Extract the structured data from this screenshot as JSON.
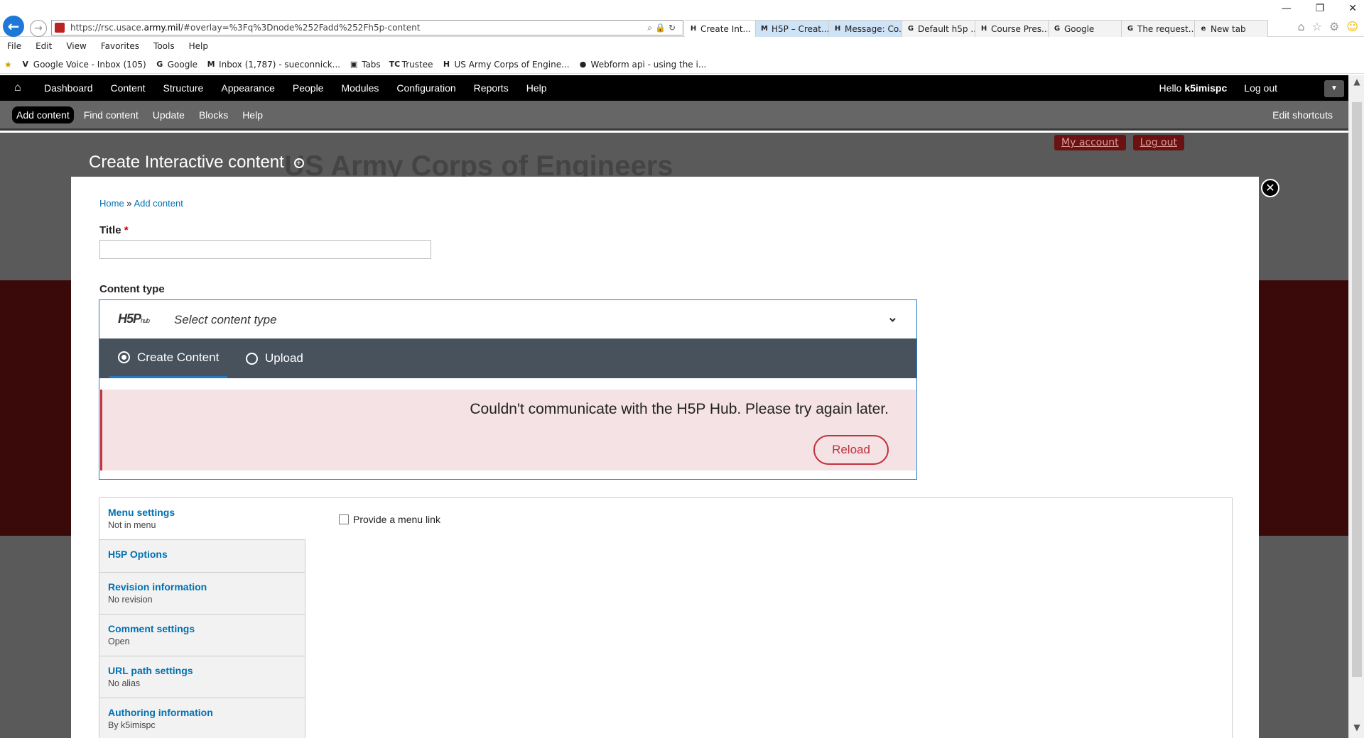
{
  "browser": {
    "url_prefix": "https://rsc.usace.",
    "url_host": "army.mil",
    "url_rest": "/#overlay=%3Fq%3Dnode%252Fadd%252Fh5p-content",
    "tabs": [
      {
        "label": "Create Int...",
        "icon": "H"
      },
      {
        "label": "H5P – Creat...",
        "icon": "M"
      },
      {
        "label": "Message: Co...",
        "icon": "H"
      },
      {
        "label": "Default h5p ...",
        "icon": "G"
      },
      {
        "label": "Course Pres...",
        "icon": "H"
      },
      {
        "label": "Google",
        "icon": "G"
      },
      {
        "label": "The request...",
        "icon": "G"
      },
      {
        "label": "New tab",
        "icon": "e"
      }
    ],
    "menu": [
      "File",
      "Edit",
      "View",
      "Favorites",
      "Tools",
      "Help"
    ],
    "favorites": [
      {
        "label": "Google Voice - Inbox (105)",
        "icon": "V"
      },
      {
        "label": "Google",
        "icon": "G"
      },
      {
        "label": "Inbox (1,787) - sueconnick...",
        "icon": "M"
      },
      {
        "label": "Tabs",
        "icon": "▣"
      },
      {
        "label": "Trustee",
        "icon": "TC"
      },
      {
        "label": "US Army Corps of Engine...",
        "icon": "H"
      },
      {
        "label": "Webform api - using the i...",
        "icon": "●"
      }
    ]
  },
  "toolbar": {
    "menu": [
      "Dashboard",
      "Content",
      "Structure",
      "Appearance",
      "People",
      "Modules",
      "Configuration",
      "Reports",
      "Help"
    ],
    "hello": "Hello ",
    "username": "k5imispc",
    "logout": "Log out"
  },
  "shortcuts": {
    "items": [
      "Add content",
      "Find content",
      "Update",
      "Blocks",
      "Help"
    ],
    "edit": "Edit shortcuts"
  },
  "site": {
    "my_account": "My account",
    "log_out": "Log out",
    "logo_text": "US Army Corps of Engineers"
  },
  "overlay": {
    "title": "Create Interactive content",
    "breadcrumb": {
      "home": "Home",
      "sep": " » ",
      "current": "Add content"
    },
    "title_label": "Title",
    "required_mark": "*",
    "content_type_label": "Content type",
    "h5p": {
      "logo": "H5P",
      "logo_sub": "hub",
      "select_text": "Select content type",
      "tab_create": "Create Content",
      "tab_upload": "Upload",
      "error": "Couldn't communicate with the H5P Hub. Please try again later.",
      "reload": "Reload"
    },
    "vtabs": [
      {
        "title": "Menu settings",
        "summary": "Not in menu"
      },
      {
        "title": "H5P Options",
        "summary": ""
      },
      {
        "title": "Revision information",
        "summary": "No revision"
      },
      {
        "title": "Comment settings",
        "summary": "Open"
      },
      {
        "title": "URL path settings",
        "summary": "No alias"
      },
      {
        "title": "Authoring information",
        "summary": "By k5imispc"
      }
    ],
    "menu_link_label": "Provide a menu link"
  },
  "colors": {
    "accent": "#2579c6",
    "error": "#c0333f",
    "link": "#0071b3"
  }
}
